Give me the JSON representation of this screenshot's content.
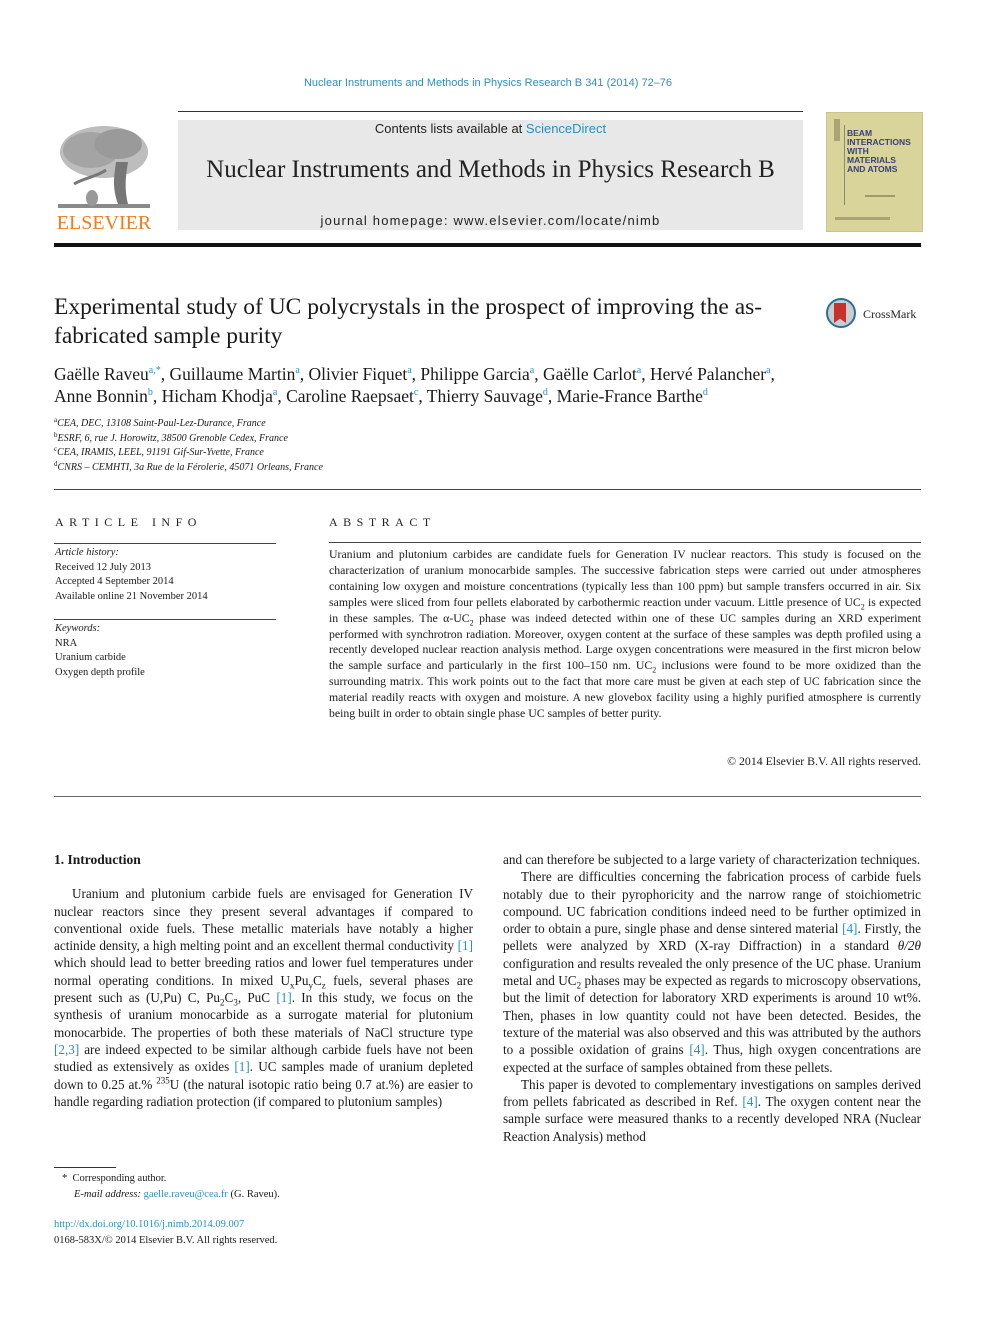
{
  "header": {
    "citation": "Nuclear Instruments and Methods in Physics Research B 341 (2014) 72–76",
    "contents_prefix": "Contents lists available at ",
    "contents_link": "ScienceDirect",
    "journal_name": "Nuclear Instruments and Methods in Physics Research B",
    "homepage_prefix": "journal homepage: ",
    "homepage_url": "www.elsevier.com/locate/nimb",
    "publisher_logo": "ELSEVIER",
    "cover_title_lines": [
      "BEAM",
      "INTERACTIONS",
      "WITH",
      "MATERIALS",
      "AND ATOMS"
    ],
    "crossmark_label": "CrossMark",
    "colors": {
      "link": "#2a8fbd",
      "elsevier_orange": "#f07c1e",
      "banner_bg": "#e8e8e8",
      "cover_bg": "#d8d49a"
    }
  },
  "article": {
    "title": "Experimental study of UC polycrystals in the prospect of improving the as-fabricated sample purity",
    "authors": [
      {
        "name": "Gaëlle Raveu",
        "sup": "a,*",
        "sep": ", "
      },
      {
        "name": "Guillaume Martin",
        "sup": "a",
        "sep": ", "
      },
      {
        "name": "Olivier Fiquet",
        "sup": "a",
        "sep": ", "
      },
      {
        "name": "Philippe Garcia",
        "sup": "a",
        "sep": ", "
      },
      {
        "name": "Gaëlle Carlot",
        "sup": "a",
        "sep": ", "
      },
      {
        "name": "Hervé Palancher",
        "sup": "a",
        "sep": ","
      },
      {
        "name": "Anne Bonnin",
        "sup": "b",
        "sep": ", "
      },
      {
        "name": "Hicham Khodja",
        "sup": "a",
        "sep": ", "
      },
      {
        "name": "Caroline Raepsaet",
        "sup": "c",
        "sep": ", "
      },
      {
        "name": "Thierry Sauvage",
        "sup": "d",
        "sep": ", "
      },
      {
        "name": "Marie-France Barthe",
        "sup": "d",
        "sep": ""
      }
    ],
    "affiliations": [
      {
        "key": "a",
        "text": "CEA, DEC, 13108 Saint-Paul-Lez-Durance, France"
      },
      {
        "key": "b",
        "text": "ESRF, 6, rue J. Horowitz, 38500 Grenoble Cedex, France"
      },
      {
        "key": "c",
        "text": "CEA, IRAMIS, LEEL, 91191 Gif-Sur-Yvette, France"
      },
      {
        "key": "d",
        "text": "CNRS – CEMHTI, 3a Rue de la Férolerie, 45071 Orleans, France"
      }
    ]
  },
  "article_info": {
    "heading": "ARTICLE INFO",
    "history_label": "Article history:",
    "received": "Received 12 July 2013",
    "accepted": "Accepted 4 September 2014",
    "online": "Available online 21 November 2014",
    "keywords_label": "Keywords:",
    "keywords": [
      "NRA",
      "Uranium carbide",
      "Oxygen depth profile"
    ]
  },
  "abstract": {
    "heading": "ABSTRACT",
    "parts": [
      "Uranium and plutonium carbides are candidate fuels for Generation IV nuclear reactors. This study is focused on the characterization of uranium monocarbide samples. The successive fabrication steps were carried out under atmospheres containing low oxygen and moisture concentrations (typically less than 100 ppm) but sample transfers occurred in air. Six samples were sliced from four pellets elaborated by carbothermic reaction under vacuum. Little presence of UC",
      "2",
      " is expected in these samples. The α-UC",
      "2",
      " phase was indeed detected within one of these UC samples during an XRD experiment performed with synchrotron radiation. Moreover, oxygen content at the surface of these samples was depth profiled using a recently developed nuclear reaction analysis method. Large oxygen concentrations were measured in the first micron below the sample surface and particularly in the first 100–150 nm. UC",
      "2",
      " inclusions were found to be more oxidized than the surrounding matrix. This work points out to the fact that more care must be given at each step of UC fabrication since the material readily reacts with oxygen and moisture. A new glovebox facility using a highly purified atmosphere is currently being built in order to obtain single phase UC samples of better purity."
    ],
    "copyright": "© 2014 Elsevier B.V. All rights reserved."
  },
  "body": {
    "section_heading": "1. Introduction",
    "left": {
      "p1": [
        "Uranium and plutonium carbide fuels are envisaged for Generation IV nuclear reactors since they present several advantages if compared to conventional oxide fuels. These metallic materials have notably a higher actinide density, a high melting point and an excellent thermal conductivity ",
        "[1]",
        " which should lead to better breeding ratios and lower fuel temperatures under normal operating conditions. In mixed U",
        "x",
        "Pu",
        "y",
        "C",
        "z",
        " fuels, several phases are present such as (U,Pu) C, Pu",
        "2",
        "C",
        "3",
        ", PuC ",
        "[1]",
        ". In this study, we focus on the synthesis of uranium monocarbide as a surrogate material for plutonium monocarbide. The properties of both these materials of NaCl structure type ",
        "[2,3]",
        " are indeed expected to be similar although carbide fuels have not been studied as extensively as oxides ",
        "[1]",
        ". UC samples made of uranium depleted down to 0.25 at.% ",
        "235",
        "U (the natural isotopic ratio being 0.7 at.%) are easier to handle regarding radiation protection (if compared to plutonium samples)"
      ]
    },
    "right": {
      "p0": "and can therefore be subjected to a large variety of characterization techniques.",
      "p2": [
        "There are difficulties concerning the fabrication process of carbide fuels notably due to their pyrophoricity and the narrow range of stoichiometric compound. UC fabrication conditions indeed need to be further optimized in order to obtain a pure, single phase and dense sintered material ",
        "[4]",
        ". Firstly, the pellets were analyzed by XRD (X-ray Diffraction) in a standard ",
        "θ/2θ",
        " configuration and results revealed the only presence of the UC phase. Uranium metal and UC",
        "2",
        " phases may be expected as regards to microscopy observations, but the limit of detection for laboratory XRD experiments is around 10 wt%. Then, phases in low quantity could not have been detected. Besides, the texture of the material was also observed and this was attributed by the authors to a possible oxidation of grains ",
        "[4]",
        ". Thus, high oxygen concentrations are expected at the surface of samples obtained from these pellets."
      ],
      "p3": [
        "This paper is devoted to complementary investigations on samples derived from pellets fabricated as described in Ref. ",
        "[4]",
        ". The oxygen content near the sample surface were measured thanks to a recently developed NRA (Nuclear Reaction Analysis) method"
      ]
    }
  },
  "footnote": {
    "marker": "*",
    "corresponding": "Corresponding author.",
    "email_label": "E-mail address: ",
    "email": "gaelle.raveu@cea.fr",
    "email_suffix": " (G. Raveu).",
    "doi": "http://dx.doi.org/10.1016/j.nimb.2014.09.007",
    "issn": "0168-583X/© 2014 Elsevier B.V. All rights reserved."
  }
}
